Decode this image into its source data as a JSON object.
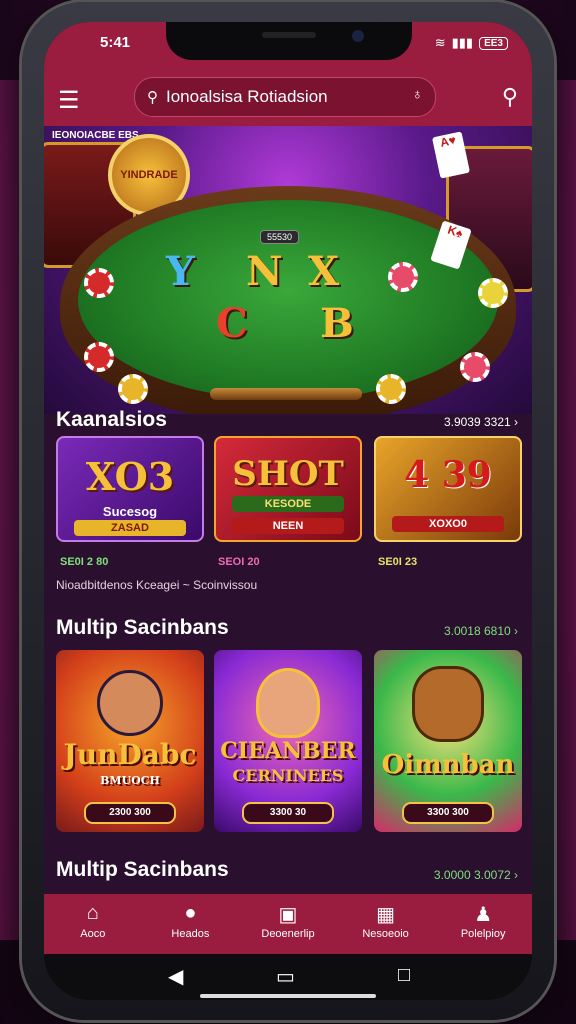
{
  "status": {
    "time": "5:41",
    "signal_icon": "wifi-icon",
    "battery": "EE3"
  },
  "header": {
    "search_text": "Ionoalsisa Rotiadsion",
    "menu_icon": "menu-icon",
    "search_icon": "search-icon",
    "mic_icon": "mic-icon"
  },
  "hero": {
    "promo_text": "IEONOIACBE EBS",
    "badge_text": "YINDRADE",
    "table_tag": "55530",
    "letters_top": [
      "Y",
      "N",
      "X"
    ],
    "letters_bottom": [
      "C",
      "B"
    ]
  },
  "section1": {
    "title": "Kaanalsios",
    "link": "3.9039 3321 ›",
    "tiles": [
      {
        "big": "XO3",
        "sub1": "Sucesog",
        "sub2": "ZASAD",
        "price": "SE0I 2 80"
      },
      {
        "big": "SHOT",
        "sub1": "KESODE",
        "sub2": "NEEN",
        "price": "SEOI 20"
      },
      {
        "big": "4 39",
        "sub1": "XOXO0",
        "sub2": "",
        "price": "SE0I 23"
      }
    ],
    "description": "Nioadbitdenos Kceagei ~ Scoinvissou"
  },
  "section2": {
    "title": "Multip Sacinbans",
    "link": "3.0018 6810 ›",
    "games": [
      {
        "name": "JunDabc",
        "sub": "BMUOCH",
        "price": "2300 300"
      },
      {
        "name": "CIEANBER",
        "sub": "CERNINEES",
        "price": "3300 30"
      },
      {
        "name": "Oimnban",
        "sub": "",
        "price": "3300 300"
      }
    ]
  },
  "section3": {
    "title": "Multip Sacinbans",
    "link": "3.0000 3.0072 ›"
  },
  "bottom_nav": [
    {
      "label": "Aoco",
      "icon": "home-icon"
    },
    {
      "label": "Heados",
      "icon": "chat-icon"
    },
    {
      "label": "Deoenerlip",
      "icon": "deposit-icon"
    },
    {
      "label": "Nesoeoio",
      "icon": "wallet-icon"
    },
    {
      "label": "Polelpioy",
      "icon": "profile-icon"
    }
  ],
  "colors": {
    "accent": "#9a1c3e",
    "background": "#2a0f2e",
    "gold": "#f6c13a",
    "green_text": "#7ee07a"
  }
}
